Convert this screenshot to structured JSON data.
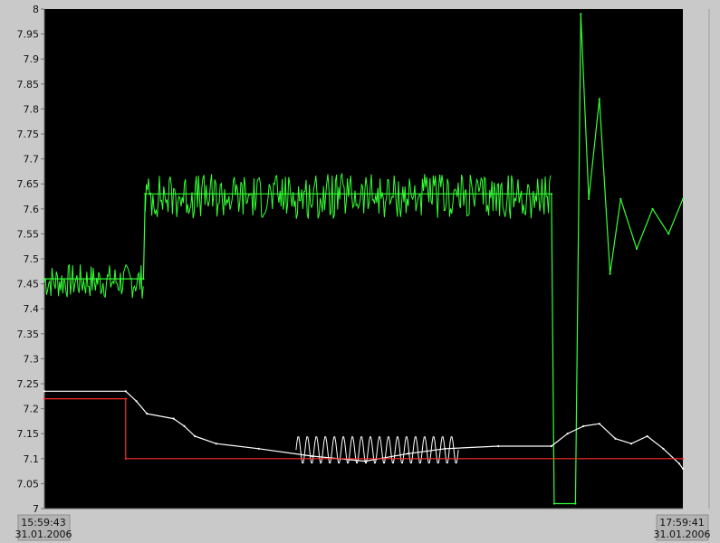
{
  "colors": {
    "background": "#c9c9c9",
    "plot_bg": "#000000",
    "series_green": "#35ff35",
    "series_white": "#ffffff",
    "series_red": "#ff2a2a",
    "frame": "#a0a0a0",
    "axis": "#707070"
  },
  "x_axis": {
    "start": {
      "time": "15:59:43",
      "date": "31.01.2006"
    },
    "end": {
      "time": "17:59:41",
      "date": "31.01.2006"
    }
  },
  "chart_data": {
    "type": "line",
    "grid": false,
    "ylim": [
      7,
      8
    ],
    "xlim": [
      "15:59:43",
      "17:59:41"
    ],
    "y_ticks": [
      "8",
      "7.95",
      "7.9",
      "7.85",
      "7.8",
      "7.75",
      "7.7",
      "7.65",
      "7.6",
      "7.55",
      "7.5",
      "7.45",
      "7.4",
      "7.35",
      "7.3",
      "7.25",
      "7.2",
      "7.15",
      "7.1",
      "7.05",
      "7"
    ],
    "series": [
      {
        "color": "#35ff35",
        "x": [
          "15:59:43",
          "16:18:20",
          "16:18:40",
          "17:35:00",
          "17:35:30",
          "17:39:30",
          "17:40:30",
          "17:42:00",
          "17:44:00",
          "17:46:00",
          "17:48:00",
          "17:51:00",
          "17:54:00",
          "17:57:00",
          "17:59:41"
        ],
        "y": [
          7.46,
          7.46,
          7.63,
          7.63,
          7.01,
          7.01,
          7.99,
          7.62,
          7.82,
          7.47,
          7.62,
          7.52,
          7.6,
          7.55,
          7.62
        ],
        "noise": [
          {
            "from": "15:59:43",
            "to": "16:18:20",
            "low": 7.42,
            "high": 7.49
          },
          {
            "from": "16:18:40",
            "to": "17:35:00",
            "low": 7.58,
            "high": 7.67
          }
        ]
      },
      {
        "color": "#ffffff",
        "x": [
          "15:59:43",
          "16:15:00",
          "16:17:00",
          "16:19:00",
          "16:24:00",
          "16:26:00",
          "16:28:00",
          "16:32:00",
          "16:40:00",
          "16:50:00",
          "17:00:00",
          "17:08:00",
          "17:15:00",
          "17:25:00",
          "17:35:00",
          "17:38:00",
          "17:41:00",
          "17:44:00",
          "17:47:00",
          "17:50:00",
          "17:53:00",
          "17:56:00",
          "17:59:00",
          "17:59:41"
        ],
        "y": [
          7.235,
          7.235,
          7.215,
          7.19,
          7.18,
          7.165,
          7.145,
          7.13,
          7.12,
          7.105,
          7.095,
          7.11,
          7.12,
          7.125,
          7.125,
          7.15,
          7.165,
          7.17,
          7.14,
          7.13,
          7.145,
          7.12,
          7.09,
          7.08
        ],
        "oscillation": {
          "from": "16:47:00",
          "to": "17:17:30",
          "low": 7.09,
          "high": 7.145
        }
      },
      {
        "color": "#ff2a2a",
        "x": [
          "15:59:43",
          "16:15:00",
          "16:15:00",
          "17:59:41"
        ],
        "y": [
          7.22,
          7.22,
          7.1,
          7.1
        ]
      }
    ]
  }
}
